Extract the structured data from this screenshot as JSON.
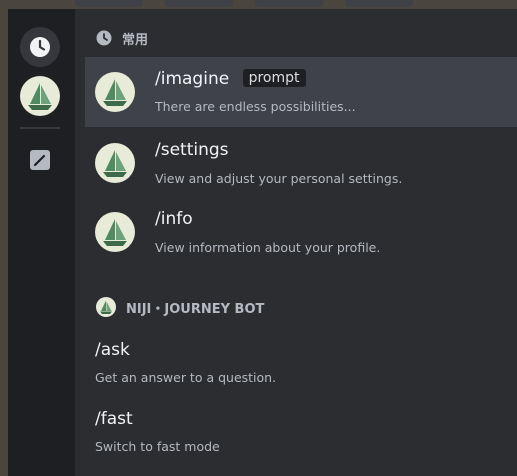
{
  "rail": {
    "clock_icon": "clock-icon",
    "bot_icon": "sailboat-avatar-icon",
    "edit_icon": "pencil-icon"
  },
  "section_frequent": {
    "title": "常用",
    "icon": "clock-icon"
  },
  "commands_frequent": [
    {
      "name": "/imagine",
      "option": "prompt",
      "description": "There are endless possibilities..."
    },
    {
      "name": "/settings",
      "description": "View and adjust your personal settings."
    },
    {
      "name": "/info",
      "description": "View information about your profile."
    }
  ],
  "section_bot": {
    "title": "NIJI・JOURNEY BOT",
    "icon": "sailboat-avatar-icon"
  },
  "commands_bot": [
    {
      "name": "/ask",
      "description": "Get an answer to a question."
    },
    {
      "name": "/fast",
      "description": "Switch to fast mode"
    }
  ],
  "colors": {
    "background": "#2b2d31",
    "rail": "#1e1f22",
    "active_row": "#404249",
    "text_primary": "#f2f3f5",
    "text_muted": "#b5bac1"
  }
}
